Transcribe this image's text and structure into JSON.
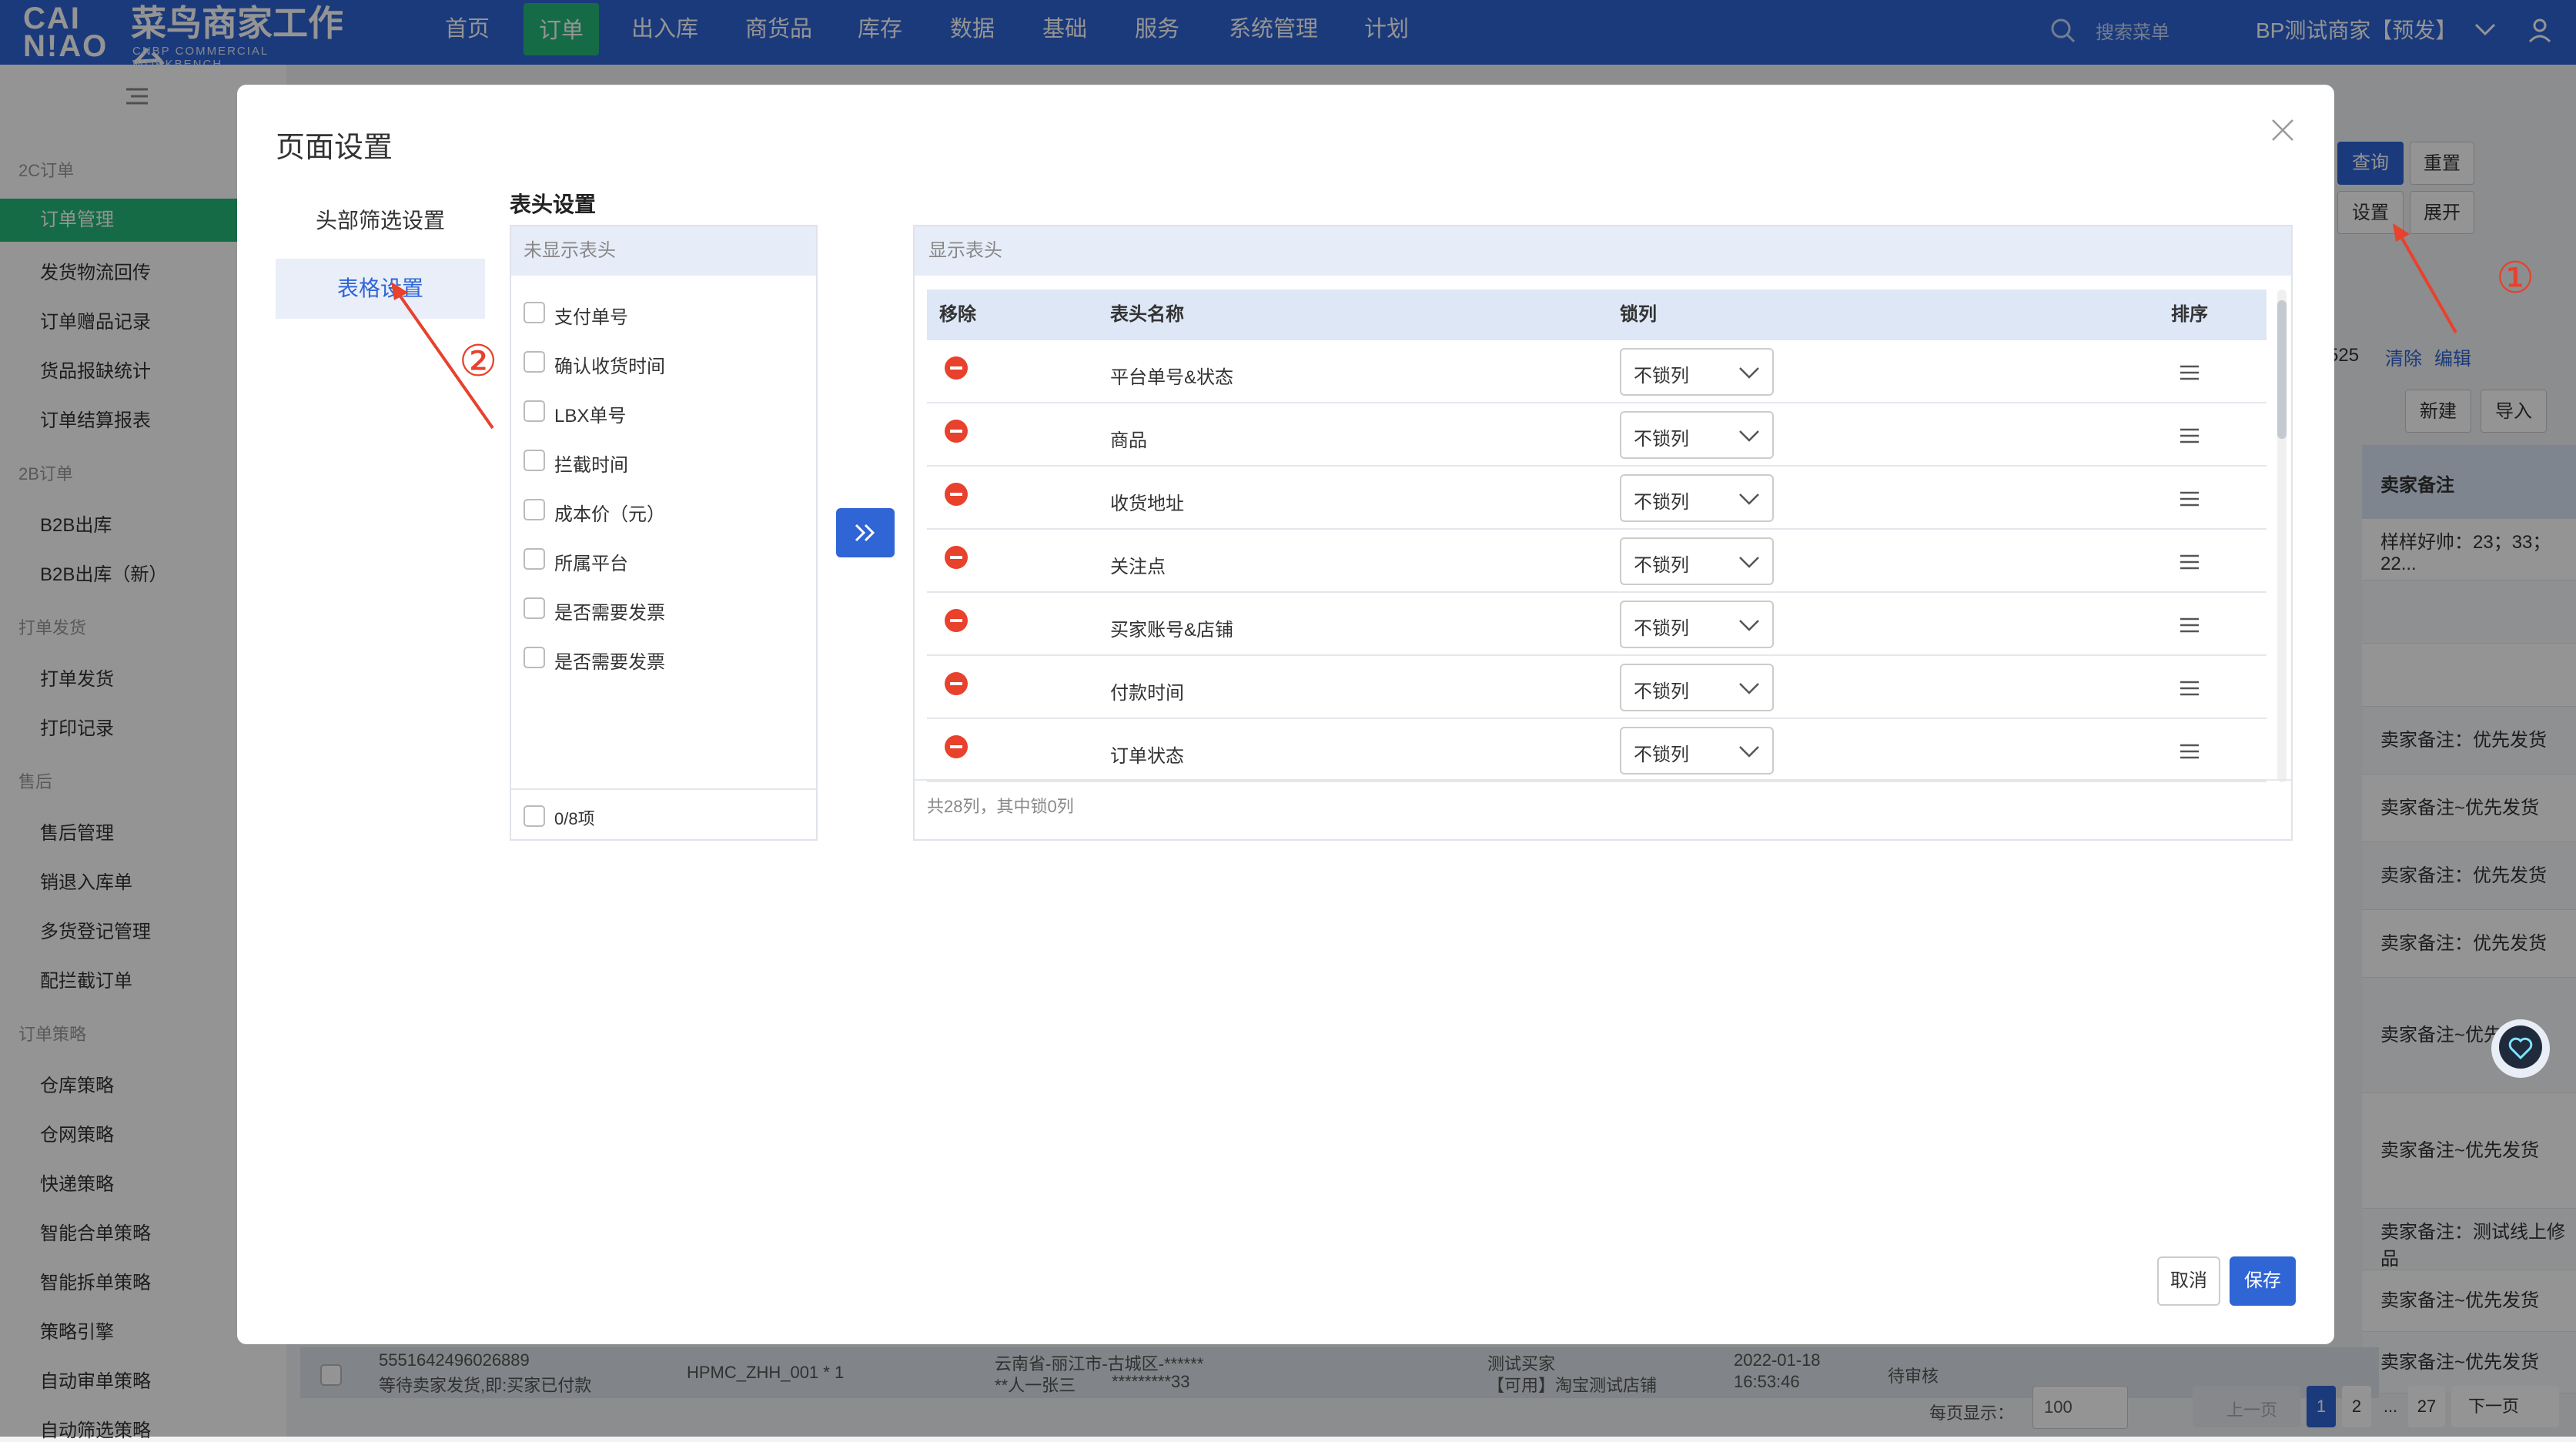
{
  "brand": {
    "logo_mark_line1": "CAI",
    "logo_mark_line2": "N!AO",
    "title": "菜鸟商家工作台",
    "subtitle": "CNBP COMMERCIAL WORKBENCH"
  },
  "topnav": {
    "items": [
      "首页",
      "订单",
      "出入库",
      "商货品",
      "库存",
      "数据",
      "基础",
      "服务",
      "系统管理",
      "计划"
    ],
    "active": "订单",
    "search_placeholder": "搜索菜单",
    "account": "BP测试商家【预发】"
  },
  "sidebar": {
    "groups": [
      {
        "label": "2C订单",
        "items": [
          "订单管理",
          "发货物流回传",
          "订单赠品记录",
          "货品报缺统计",
          "订单结算报表"
        ]
      },
      {
        "label": "2B订单",
        "items": [
          "B2B出库",
          "B2B出库（新）"
        ]
      },
      {
        "label": "打单发货",
        "items": [
          "打单发货",
          "打印记录"
        ]
      },
      {
        "label": "售后",
        "items": [
          "售后管理",
          "销退入库单",
          "多货登记管理",
          "配拦截订单"
        ]
      },
      {
        "label": "订单策略",
        "items": [
          "仓库策略",
          "仓网策略",
          "快递策略",
          "智能合单策略",
          "智能拆单策略",
          "策略引擎",
          "自动审单策略",
          "自动筛选策略"
        ]
      }
    ],
    "active_item": "订单管理"
  },
  "background": {
    "buttons": {
      "query": "查询",
      "reset": "重置",
      "settings": "设置",
      "expand": "展开",
      "new": "新建",
      "import": "导入"
    },
    "count_fragment": "525",
    "links": {
      "clear": "清除",
      "edit": "编辑"
    },
    "seller_note_header": "卖家备注",
    "seller_notes": [
      "样样好帅：23；33；22...",
      "",
      "",
      "卖家备注：优先发货",
      "卖家备注~优先发货",
      "卖家备注：优先发货",
      "卖家备注：优先发货",
      "卖家备注~优先",
      "卖家备注~优先发货",
      "卖家备注：测试线上修品",
      "卖家备注~优先发货",
      "卖家备注~优先发货"
    ],
    "bottom_row": {
      "order_no": "5551642496026889",
      "order_status": "等待卖家发货,即:买家已付款",
      "item": "HPMC_ZHH_001 * 1",
      "address": "云南省-丽江市-古城区-******",
      "receiver": "**人一张三",
      "phone": "*********33",
      "buyer": "测试买家",
      "shop": "【可用】淘宝测试店铺",
      "date": "2022-01-18",
      "time": "16:53:46",
      "status": "待审核"
    },
    "pager": {
      "per_page_label": "每页显示：",
      "per_page": "100",
      "prev": "上一页",
      "pages": [
        "1",
        "2",
        "...",
        "27"
      ],
      "current": "1",
      "next": "下一页"
    }
  },
  "modal": {
    "title": "页面设置",
    "nav": [
      "头部筛选设置",
      "表格设置"
    ],
    "active_nav": "表格设置",
    "section_title": "表头设置",
    "hidden_panel": {
      "title": "未显示表头",
      "items": [
        "支付单号",
        "确认收货时间",
        "LBX单号",
        "拦截时间",
        "成本价（元）",
        "所属平台",
        "是否需要发票",
        "是否需要发票"
      ],
      "footer": "0/8项"
    },
    "shown_panel": {
      "title": "显示表头",
      "columns": {
        "remove": "移除",
        "name": "表头名称",
        "lock": "锁列",
        "sort": "排序"
      },
      "rows": [
        {
          "name": "平台单号&状态",
          "lock": "不锁列"
        },
        {
          "name": "商品",
          "lock": "不锁列"
        },
        {
          "name": "收货地址",
          "lock": "不锁列"
        },
        {
          "name": "关注点",
          "lock": "不锁列"
        },
        {
          "name": "买家账号&店铺",
          "lock": "不锁列"
        },
        {
          "name": "付款时间",
          "lock": "不锁列"
        },
        {
          "name": "订单状态",
          "lock": "不锁列"
        }
      ],
      "footer": "共28列，其中锁0列"
    },
    "buttons": {
      "cancel": "取消",
      "save": "保存"
    }
  },
  "annotations": {
    "marker1": "①",
    "marker2": "②",
    "color": "#e8412c"
  },
  "colors": {
    "primary": "#2f65d4",
    "active_green": "#27b87a",
    "remove_red": "#e8412c"
  }
}
